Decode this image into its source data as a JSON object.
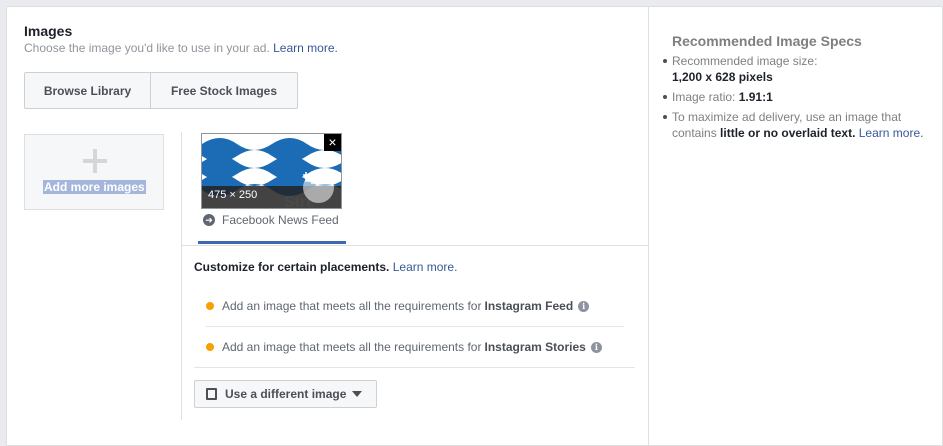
{
  "images": {
    "title": "Images",
    "subtitle": "Choose the image you'd like to use in your ad.",
    "learn_more": "Learn more."
  },
  "buttons": {
    "browse_library": "Browse Library",
    "free_stock": "Free Stock Images"
  },
  "add_more": {
    "label": "Add more images",
    "icon": "plus-icon"
  },
  "thumbnail": {
    "size_label": "475 × 250",
    "close_icon": "close-icon",
    "crop_icon": "crop-icon",
    "image_text": "Stre"
  },
  "placement": {
    "label": "Facebook News Feed",
    "icon": "arrow-right-circle-icon"
  },
  "customize": {
    "bold_text": "Customize for certain placements.",
    "learn_more": "Learn more."
  },
  "requirements": [
    {
      "prefix": "Add an image that meets all the requirements for",
      "target": "Instagram Feed"
    },
    {
      "prefix": "Add an image that meets all the requirements for",
      "target": "Instagram Stories"
    }
  ],
  "different_image": {
    "label": "Use a different image"
  },
  "specs": {
    "title": "Recommended Image Specs",
    "size_label": "Recommended image size:",
    "size_value": "1,200 x 628 pixels",
    "ratio_label": "Image ratio:",
    "ratio_value": "1.91:1",
    "delivery_prefix": "To maximize ad delivery, use an image that contains",
    "delivery_bold": "little or no overlaid text.",
    "delivery_link": "Learn more."
  },
  "colors": {
    "link": "#365899",
    "accent": "#4267b2",
    "warning_dot": "#f7a000",
    "wave_blue": "#1b6bb5"
  }
}
